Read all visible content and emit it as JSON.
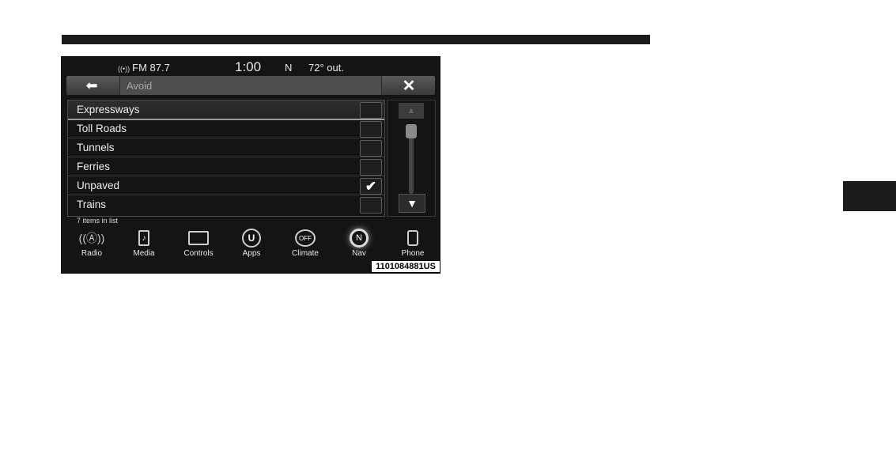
{
  "status_bar": {
    "radio": "FM 87.7",
    "time": "1:00",
    "heading": "N",
    "temperature": "72° out."
  },
  "header": {
    "back_icon": "left-arrow-icon",
    "title_placeholder": "Avoid",
    "close_icon": "close-icon"
  },
  "list": {
    "items": [
      {
        "label": "Expressways",
        "checked": false
      },
      {
        "label": "Toll Roads",
        "checked": false
      },
      {
        "label": "Tunnels",
        "checked": false
      },
      {
        "label": "Ferries",
        "checked": false
      },
      {
        "label": "Unpaved",
        "checked": true
      },
      {
        "label": "Trains",
        "checked": false
      }
    ],
    "count_text": "7 items in list"
  },
  "nav": {
    "items": [
      {
        "label": "Radio",
        "icon": "antenna-icon"
      },
      {
        "label": "Media",
        "icon": "media-icon"
      },
      {
        "label": "Controls",
        "icon": "controls-icon"
      },
      {
        "label": "Apps",
        "icon": "apps-icon"
      },
      {
        "label": "Climate",
        "icon": "climate-icon",
        "icon_text": "OFF"
      },
      {
        "label": "Nav",
        "icon": "compass-icon",
        "icon_text": "N",
        "active": true
      },
      {
        "label": "Phone",
        "icon": "phone-icon"
      }
    ]
  },
  "figure_id": "1101084881US",
  "colors": {
    "screen_bg": "#141414",
    "text": "#ededed",
    "page_bg": "#ffffff"
  }
}
